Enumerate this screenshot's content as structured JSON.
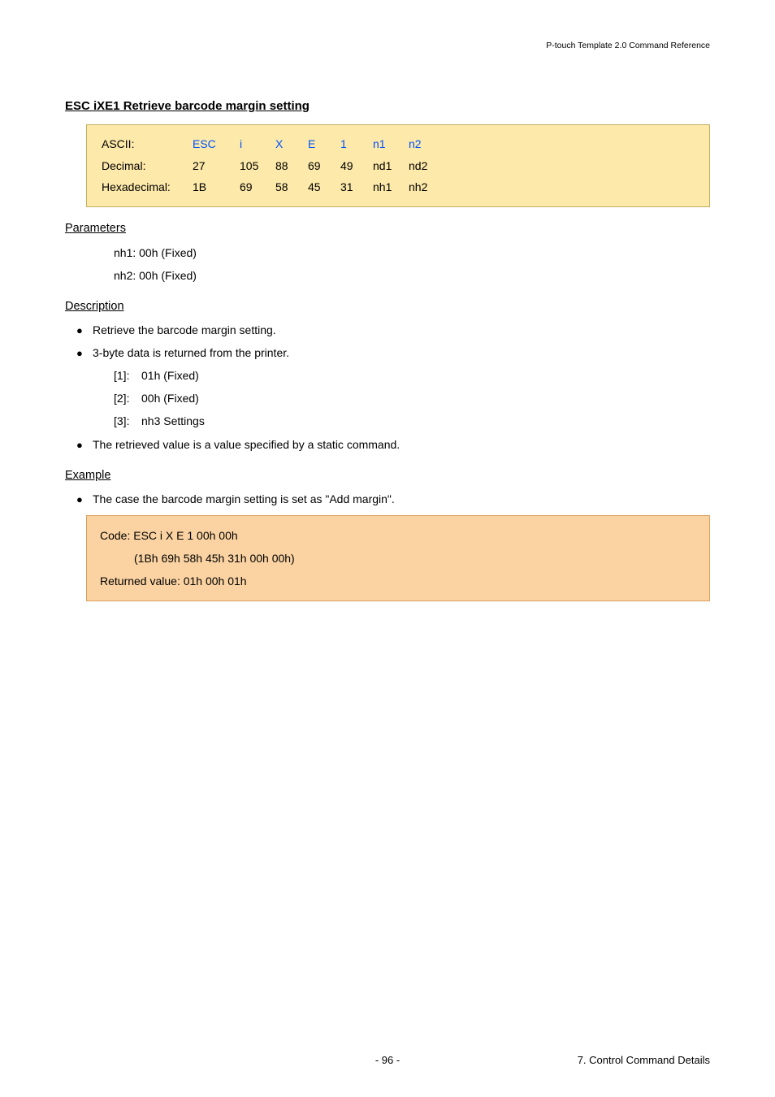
{
  "header": {
    "doc_title": "P-touch Template 2.0 Command Reference"
  },
  "section": {
    "title": "ESC iXE1   Retrieve barcode margin setting"
  },
  "codetable": {
    "rows": [
      {
        "label": "ASCII:",
        "cells": [
          "ESC",
          "i",
          "X",
          "E",
          "1",
          "n1",
          "n2"
        ],
        "blue": true
      },
      {
        "label": "Decimal:",
        "cells": [
          "27",
          "105",
          "88",
          "69",
          "49",
          "nd1",
          "nd2"
        ],
        "blue": false
      },
      {
        "label": "Hexadecimal:",
        "cells": [
          "1B",
          "69",
          "58",
          "45",
          "31",
          "nh1",
          "nh2"
        ],
        "blue": false
      }
    ]
  },
  "parameters": {
    "heading": "Parameters",
    "lines": [
      "nh1: 00h (Fixed)",
      "nh2: 00h (Fixed)"
    ]
  },
  "description": {
    "heading": "Description",
    "bullets": [
      "Retrieve the barcode margin setting.",
      "3-byte data is returned from the printer."
    ],
    "numbered": [
      {
        "n": "[1]:",
        "t": "01h (Fixed)"
      },
      {
        "n": "[2]:",
        "t": "00h (Fixed)"
      },
      {
        "n": "[3]:",
        "t": "nh3 Settings"
      }
    ],
    "bullets_after": [
      "The retrieved value is a value specified by a static command."
    ]
  },
  "example": {
    "heading": "Example",
    "bullet": "The case the barcode margin setting is set as \"Add margin\".",
    "box": {
      "line1": "Code: ESC i X E 1 00h 00h",
      "line2": "(1Bh 69h 58h 45h 31h 00h 00h)",
      "line3": "Returned value: 01h 00h 01h"
    }
  },
  "footer": {
    "page": "- 96 -",
    "section": "7. Control Command Details"
  }
}
